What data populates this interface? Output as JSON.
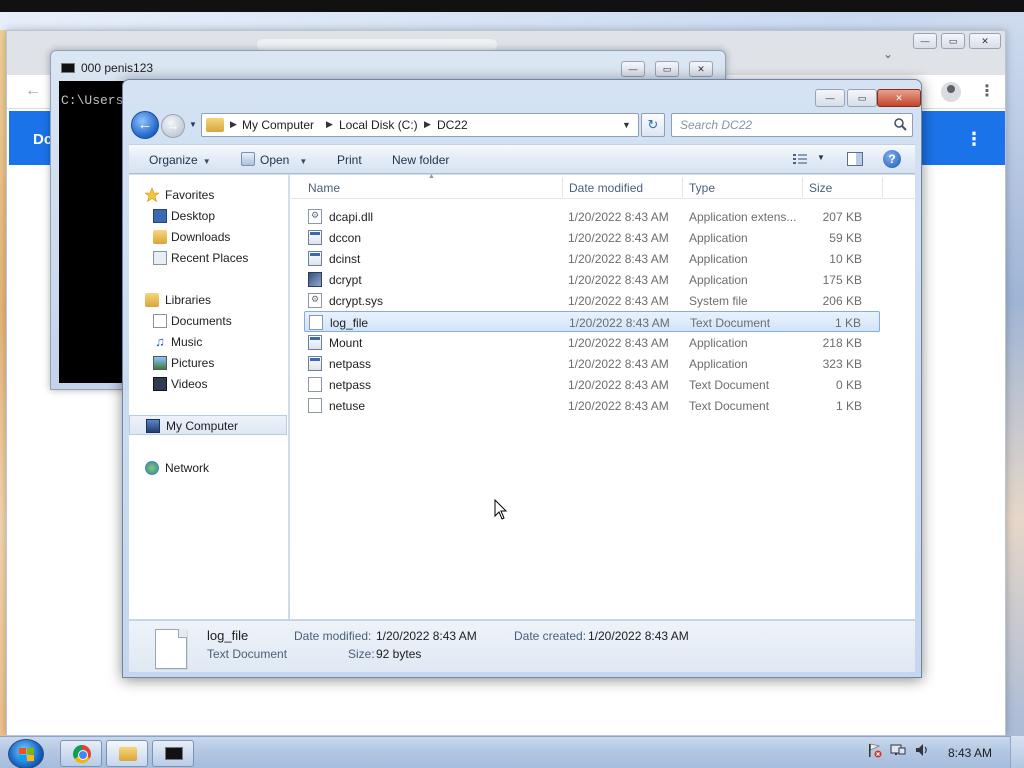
{
  "chrome": {
    "banner_text": "Dc",
    "back_glyph": "←",
    "menu_glyph": "⋮",
    "tab_chevron_glyph": "⌄"
  },
  "console": {
    "title": "000  penis123",
    "prompt_text": "C:\\Users"
  },
  "explorer": {
    "window_buttons": {
      "minimize": "—",
      "maximize": "▭",
      "close": "✕"
    },
    "breadcrumb": [
      "My Computer",
      "Local Disk (C:)",
      "DC22"
    ],
    "search_placeholder": "Search DC22",
    "commands": {
      "organize": "Organize",
      "open": "Open",
      "print": "Print",
      "new_folder": "New folder"
    },
    "nav": {
      "favorites": "Favorites",
      "favorites_items": [
        "Desktop",
        "Downloads",
        "Recent Places"
      ],
      "libraries": "Libraries",
      "libraries_items": [
        "Documents",
        "Music",
        "Pictures",
        "Videos"
      ],
      "my_computer": "My Computer",
      "network": "Network"
    },
    "columns": {
      "name": "Name",
      "date": "Date modified",
      "type": "Type",
      "size": "Size"
    },
    "files": [
      {
        "name": "dcapi.dll",
        "date": "1/20/2022 8:43 AM",
        "type": "Application extens...",
        "size": "207 KB",
        "icon": "system-file-icon"
      },
      {
        "name": "dccon",
        "date": "1/20/2022 8:43 AM",
        "type": "Application",
        "size": "59 KB",
        "icon": "application-icon"
      },
      {
        "name": "dcinst",
        "date": "1/20/2022 8:43 AM",
        "type": "Application",
        "size": "10 KB",
        "icon": "application-icon"
      },
      {
        "name": "dcrypt",
        "date": "1/20/2022 8:43 AM",
        "type": "Application",
        "size": "175 KB",
        "icon": "dcrypt-app-icon"
      },
      {
        "name": "dcrypt.sys",
        "date": "1/20/2022 8:43 AM",
        "type": "System file",
        "size": "206 KB",
        "icon": "system-file-icon"
      },
      {
        "name": "log_file",
        "date": "1/20/2022 8:43 AM",
        "type": "Text Document",
        "size": "1 KB",
        "icon": "text-document-icon",
        "selected": true
      },
      {
        "name": "Mount",
        "date": "1/20/2022 8:43 AM",
        "type": "Application",
        "size": "218 KB",
        "icon": "application-icon"
      },
      {
        "name": "netpass",
        "date": "1/20/2022 8:43 AM",
        "type": "Application",
        "size": "323 KB",
        "icon": "application-icon"
      },
      {
        "name": "netpass",
        "date": "1/20/2022 8:43 AM",
        "type": "Text Document",
        "size": "0 KB",
        "icon": "text-document-icon"
      },
      {
        "name": "netuse",
        "date": "1/20/2022 8:43 AM",
        "type": "Text Document",
        "size": "1 KB",
        "icon": "text-document-icon"
      }
    ],
    "details": {
      "name": "log_file",
      "type": "Text Document",
      "date_modified_label": "Date modified:",
      "date_modified": "1/20/2022 8:43 AM",
      "date_created_label": "Date created:",
      "date_created": "1/20/2022 8:43 AM",
      "size_label": "Size:",
      "size": "92 bytes"
    }
  },
  "taskbar": {
    "clock": "8:43 AM"
  },
  "colors": {
    "selection": "#d2e4fa",
    "chrome_banner": "#1a73e8",
    "console_bg": "#000000"
  }
}
